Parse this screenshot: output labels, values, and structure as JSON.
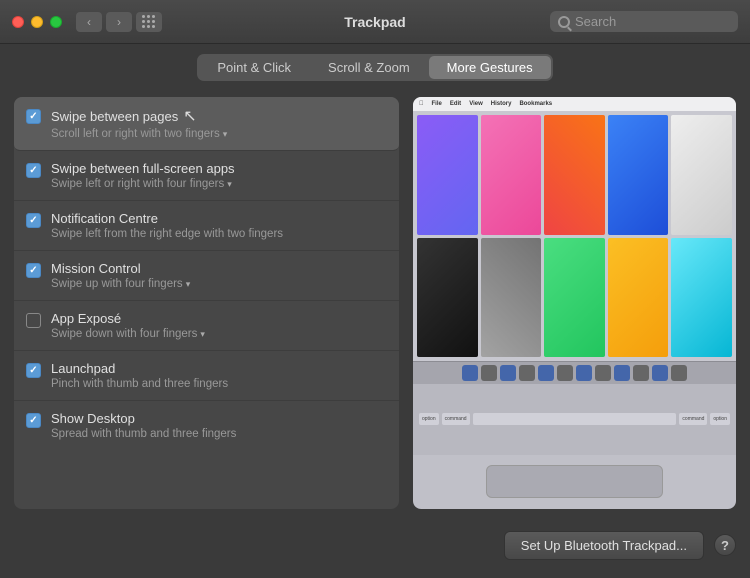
{
  "window": {
    "title": "Trackpad",
    "search_placeholder": "Search"
  },
  "tabs": [
    {
      "id": "point-click",
      "label": "Point & Click",
      "active": false
    },
    {
      "id": "scroll-zoom",
      "label": "Scroll & Zoom",
      "active": false
    },
    {
      "id": "more-gestures",
      "label": "More Gestures",
      "active": true
    }
  ],
  "gestures": [
    {
      "id": "swipe-between-pages",
      "title": "Swipe between pages",
      "subtitle": "Scroll left or right with two fingers",
      "checked": true,
      "selected": true,
      "has_dropdown": true
    },
    {
      "id": "swipe-between-apps",
      "title": "Swipe between full-screen apps",
      "subtitle": "Swipe left or right with four fingers",
      "checked": true,
      "selected": false,
      "has_dropdown": true
    },
    {
      "id": "notification-centre",
      "title": "Notification Centre",
      "subtitle": "Swipe left from the right edge with two fingers",
      "checked": true,
      "selected": false,
      "has_dropdown": false
    },
    {
      "id": "mission-control",
      "title": "Mission Control",
      "subtitle": "Swipe up with four fingers",
      "checked": true,
      "selected": false,
      "has_dropdown": true
    },
    {
      "id": "app-expose",
      "title": "App Exposé",
      "subtitle": "Swipe down with four fingers",
      "checked": false,
      "selected": false,
      "has_dropdown": true
    },
    {
      "id": "launchpad",
      "title": "Launchpad",
      "subtitle": "Pinch with thumb and three fingers",
      "checked": true,
      "selected": false,
      "has_dropdown": false
    },
    {
      "id": "show-desktop",
      "title": "Show Desktop",
      "subtitle": "Spread with thumb and three fingers",
      "checked": true,
      "selected": false,
      "has_dropdown": false
    }
  ],
  "bottom": {
    "setup_btn_label": "Set Up Bluetooth Trackpad...",
    "help_label": "?"
  }
}
